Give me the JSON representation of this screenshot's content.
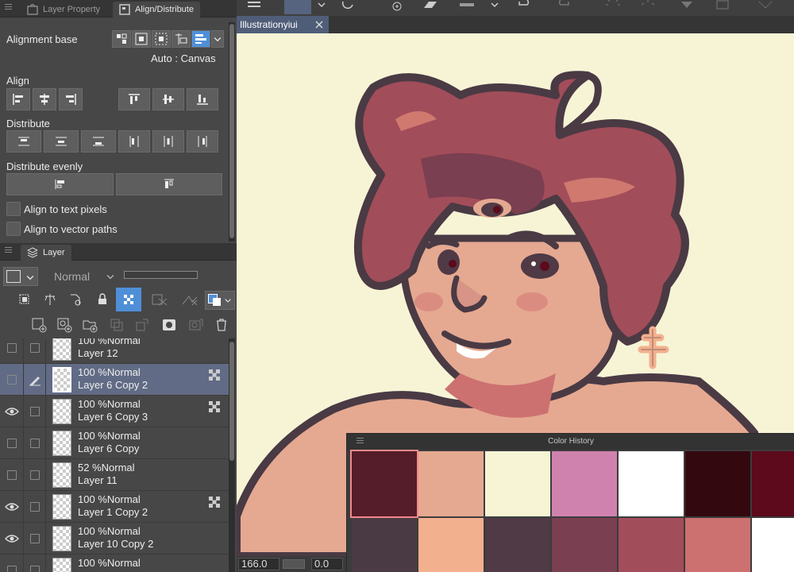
{
  "panels": {
    "top_tabs": [
      {
        "label": "Layer Property"
      },
      {
        "label": "Align/Distribute"
      }
    ],
    "align": {
      "alignment_base_label": "Alignment base",
      "base_value": "Auto : Canvas",
      "align_label": "Align",
      "distribute_label": "Distribute",
      "distribute_evenly_label": "Distribute evenly",
      "text_pixels_label": "Align to text pixels",
      "vector_paths_label": "Align to vector paths"
    },
    "layer_tab": {
      "label": "Layer"
    },
    "blend_mode": "Normal"
  },
  "layers": [
    {
      "opacity": "100 %",
      "mode": "Normal",
      "name": "Layer 12",
      "visible": false,
      "selected": false,
      "editing": false,
      "ref": false
    },
    {
      "opacity": "100 %",
      "mode": "Normal",
      "name": "Layer 6 Copy 2",
      "visible": false,
      "selected": true,
      "editing": true,
      "ref": true
    },
    {
      "opacity": "100 %",
      "mode": "Normal",
      "name": "Layer 6 Copy 3",
      "visible": true,
      "selected": false,
      "editing": false,
      "ref": true
    },
    {
      "opacity": "100 %",
      "mode": "Normal",
      "name": "Layer 6 Copy",
      "visible": false,
      "selected": false,
      "editing": false,
      "ref": false
    },
    {
      "opacity": "52 %",
      "mode": "Normal",
      "name": "Layer 11",
      "visible": false,
      "selected": false,
      "editing": false,
      "ref": false
    },
    {
      "opacity": "100 %",
      "mode": "Normal",
      "name": "Layer 1 Copy 2",
      "visible": true,
      "selected": false,
      "editing": false,
      "ref": true
    },
    {
      "opacity": "100 %",
      "mode": "Normal",
      "name": "Layer 10 Copy 2",
      "visible": true,
      "selected": false,
      "editing": false,
      "ref": false
    },
    {
      "opacity": "100 %",
      "mode": "Normal",
      "name": "",
      "visible": false,
      "selected": false,
      "editing": false,
      "ref": false
    }
  ],
  "document": {
    "tab_title": "Illustrationyiui"
  },
  "status": {
    "zoom": "166.0",
    "angle": "0.0"
  },
  "color_history": {
    "title": "Color History",
    "row1": [
      "#551c2a",
      "#e5a991",
      "#f7f4d6",
      "#d082ae",
      "#ffffff",
      "#33090f",
      "#5c0a1c"
    ],
    "row2": [
      "#4a3a44",
      "#f3b08e",
      "#4f3a45",
      "#7a3f50",
      "#a24d5a",
      "#cc7170",
      "#ffffff"
    ]
  },
  "colors": {
    "selection": "#616b85",
    "accent": "#4f8fd8"
  }
}
